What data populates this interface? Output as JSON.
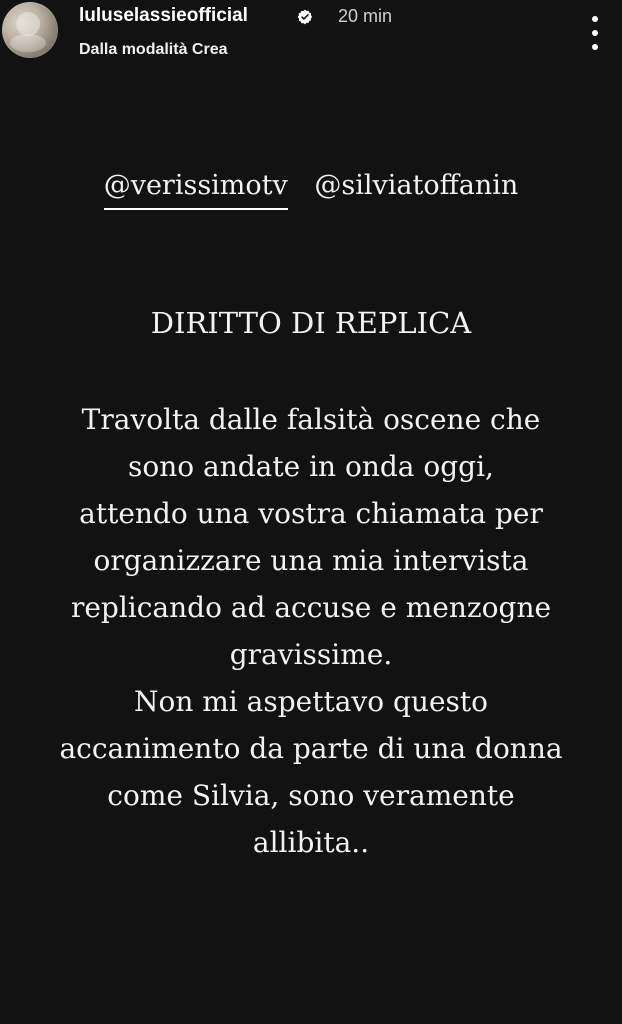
{
  "header": {
    "username": "luluselassieofficial",
    "verified": true,
    "time": "20 min",
    "subtitle": "Dalla modalità Crea",
    "avatar_icon": "profile-avatar",
    "menu_icon": "more-vertical-icon"
  },
  "story": {
    "mentions": [
      "@verissimotv",
      "@silviatoffanin"
    ],
    "title": "DIRITTO DI REPLICA",
    "lines": [
      "Travolta dalle falsità oscene che",
      "sono andate in onda oggi,",
      "attendo una vostra chiamata per",
      "organizzare una mia intervista",
      "replicando ad accuse e menzogne",
      "gravissime.",
      "Non mi aspettavo questo",
      "accanimento da parte di una donna",
      "come Silvia,  sono veramente",
      "allibita.."
    ]
  },
  "colors": {
    "background": "#121212",
    "text": "#f2f2f2"
  }
}
